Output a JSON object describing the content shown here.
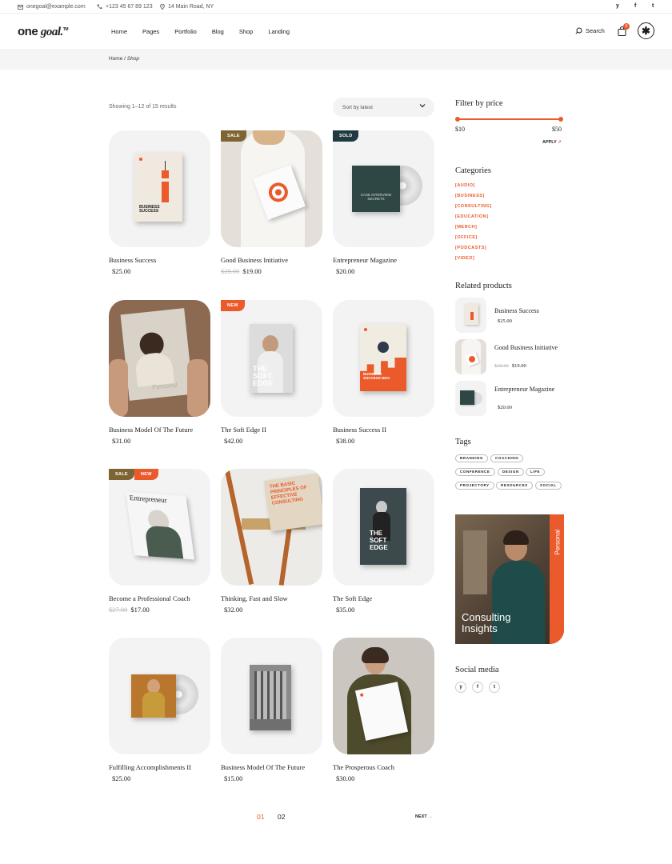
{
  "topbar": {
    "email": "onegoal@example.com",
    "phone": "+123 45 67 89 123",
    "address": "14 Main Road, NY",
    "social": [
      "y",
      "f",
      "t"
    ]
  },
  "header": {
    "logo_main": "one",
    "logo_italic": "goal.",
    "logo_tm": "TM",
    "nav": [
      "Home",
      "Pages",
      "Portfolio",
      "Blog",
      "Shop",
      "Landing"
    ],
    "search_label": "Search",
    "cart_count": "0",
    "menu_symbol": "✱"
  },
  "breadcrumb": {
    "home": "Home",
    "sep": " / ",
    "current": "Shop"
  },
  "results": {
    "showing": "Showing 1–12 of 15 results",
    "sort_label": "Sort by latest"
  },
  "products": [
    {
      "name": "Business Success",
      "price": "$25.00",
      "old_price": "",
      "badges": []
    },
    {
      "name": "Good Business Initiative",
      "price": "$19.00",
      "old_price": "$28.00",
      "badges": [
        "SALE"
      ]
    },
    {
      "name": "Entrepreneur Magazine",
      "price": "$20.00",
      "old_price": "",
      "badges": [
        "SOLD"
      ]
    },
    {
      "name": "Business Model Of The Future",
      "price": "$31.00",
      "old_price": "",
      "badges": []
    },
    {
      "name": "The Soft Edge II",
      "price": "$42.00",
      "old_price": "",
      "badges": [
        "NEW"
      ]
    },
    {
      "name": "Business Success II",
      "price": "$38.00",
      "old_price": "",
      "badges": []
    },
    {
      "name": "Become a Professional Coach",
      "price": "$17.00",
      "old_price": "$27.00",
      "badges": [
        "SALE",
        "NEW"
      ]
    },
    {
      "name": "Thinking, Fast and Slow",
      "price": "$32.00",
      "old_price": "",
      "badges": []
    },
    {
      "name": "The Soft Edge",
      "price": "$35.00",
      "old_price": "",
      "badges": []
    },
    {
      "name": "Fulfilling Accomplishments II",
      "price": "$25.00",
      "old_price": "",
      "badges": []
    },
    {
      "name": "Business Model Of The Future",
      "price": "$15.00",
      "old_price": "",
      "badges": []
    },
    {
      "name": "The Prosperous Coach",
      "price": "$30.00",
      "old_price": "",
      "badges": []
    }
  ],
  "cover_text": {
    "p1": "BUSINESS SUCCESS",
    "p3": "CASE INTERVIEW SECRETS",
    "p5": "THE SOFT EDGE",
    "p6": "BUSINESS SUCCESS NEO.",
    "p7": "Entrepreneur",
    "p8": "THE BASIC PRINCIPLES OF EFFECTIVE CONSULTING",
    "p9": "THE SOFT EDGE",
    "p4": "Personal"
  },
  "sidebar": {
    "price_title": "Filter by price",
    "price_min": "$10",
    "price_max": "$50",
    "apply": "APPLY",
    "categories_title": "Categories",
    "categories": [
      "[AUDIO]",
      "[BUSINESS]",
      "[CONSULTING]",
      "[EDUCATION]",
      "[MERCH]",
      "[OFFICE]",
      "[PODCASTS]",
      "[VIDEO]"
    ],
    "related_title": "Related products",
    "related": [
      {
        "name": "Business Success",
        "price": "$25.00",
        "old_price": ""
      },
      {
        "name": "Good Business Initiative",
        "price": "$19.00",
        "old_price": "$28.00"
      },
      {
        "name": "Entrepreneur Magazine",
        "price": "$20.00",
        "old_price": ""
      }
    ],
    "tags_title": "Tags",
    "tags": [
      "BRANDING",
      "COACHING",
      "CONFERENCE",
      "DESIGN",
      "LIFE",
      "PROJECTORY",
      "RESOURCES",
      "SOCIAL"
    ],
    "promo_title": "Consulting Insights",
    "promo_side": "Personal",
    "social_title": "Social media",
    "social": [
      "y",
      "f",
      "t"
    ]
  },
  "pagination": {
    "pages": [
      "01",
      "02"
    ],
    "current": "01",
    "next": "NEXT"
  },
  "colors": {
    "accent": "#ea5a2b",
    "sale": "#7d6433",
    "sold": "#1f3a40",
    "card_bg": "#f3f3f3"
  }
}
